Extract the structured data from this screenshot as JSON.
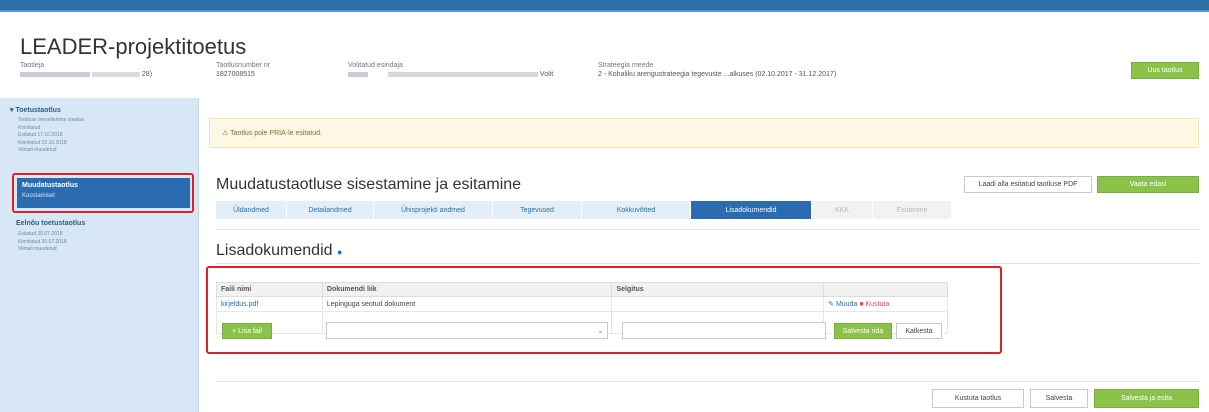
{
  "app_title": "LEADER-projektitoetus",
  "header": {
    "applicant": {
      "label": "Taotleja",
      "value_suffix": "28)"
    },
    "app_number": {
      "label": "Taotlusnumber nr",
      "value": "1827008515"
    },
    "representative": {
      "label": "Volitatud esindaja",
      "value_suffix": "Volit"
    },
    "strategy": {
      "label": "Strateegia meede",
      "value": "2 - Kohaliku arengustrateegia tegevuste ...alkuses (02.10.2017 - 31.12.2017)"
    },
    "action_button": "Uus taotlus"
  },
  "sidebar": {
    "items": [
      {
        "title": "Toetustaotlus",
        "lines": [
          "Tootluse menetlemise staatus",
          "Kinnitatud",
          "Esitatud 17.10.2018",
          "Kinnitatud 22.10.2018",
          "Viimati muudetud"
        ]
      },
      {
        "title": "Muudatustaotlus",
        "lines": [
          "Koostamisel"
        ]
      },
      {
        "title": "Eelnõu toetustaotlus",
        "lines": [
          "Esitatud 25.07.2018",
          "Kinnitatud 30.07.2018",
          "Viimati muudetud"
        ]
      }
    ]
  },
  "warning": {
    "icon": "warning-icon",
    "text": "Taotlus pole PRIA-le esitatud."
  },
  "main": {
    "title": "Muudatustaotluse sisestamine ja esitamine",
    "pdf_button": "Laadi alla esitatud taotluse PDF",
    "next_button": "Vaata edasi",
    "steps": [
      {
        "label": "Üldandmed",
        "state": "normal"
      },
      {
        "label": "Detailandmed",
        "state": "normal"
      },
      {
        "label": "Ühisprojekti andmed",
        "state": "normal"
      },
      {
        "label": "Tegevused",
        "state": "normal"
      },
      {
        "label": "Kokkuvõtted",
        "state": "normal"
      },
      {
        "label": "Lisadokumendid",
        "state": "active"
      },
      {
        "label": "KKK",
        "state": "disabled"
      },
      {
        "label": "Esitamine",
        "state": "disabled"
      }
    ]
  },
  "attachments": {
    "title": "Lisadokumendid",
    "columns": [
      "Faili nimi",
      "Dokumendi liik",
      "Selgitus",
      ""
    ],
    "rows": [
      {
        "file": "kirjeldus.pdf",
        "type": "Lepinguga seotud dokument",
        "note": "",
        "edit": "Muuda",
        "remove": "Kustuta"
      }
    ],
    "add_button": "+ Lisa fail",
    "save_button": "Salvesta rida",
    "cancel_button": "Katkesta"
  },
  "footer": {
    "delete_button": "Kustuta taotlus",
    "save_button": "Salvesta",
    "save_submit_button": "Salvesta ja esita"
  },
  "colors": {
    "accent": "#2b6cb0",
    "green": "#8bc34a",
    "highlight": "#d9222a",
    "warning_bg": "#fcf8e3"
  }
}
